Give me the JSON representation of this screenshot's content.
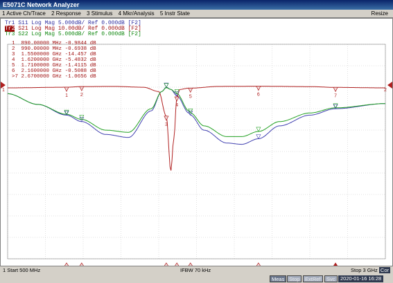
{
  "window": {
    "title": "E5071C Network Analyzer"
  },
  "menu": {
    "items": [
      "1 Active Ch/Trace",
      "2 Response",
      "3 Stimulus",
      "4 Mkr/Analysis",
      "5 Instr State"
    ],
    "resize": "Resize"
  },
  "traces": {
    "tr1": {
      "id": "Tr1",
      "label": "S11 Log Mag 5.000dB/ Ref 0.000dB [F2]"
    },
    "tr2": {
      "id": "Tr2",
      "label": "S21 Log Mag 10.00dB/ Ref 0.000dB [F2]"
    },
    "tr3": {
      "id": "Tr3",
      "label": "S22 Log Mag 5.000dB/ Ref 0.000dB [F2]"
    }
  },
  "markers": [
    {
      "num": "1",
      "freq": "890.00000 MHz",
      "val": "-0.9844 dB"
    },
    {
      "num": "2",
      "freq": "990.00000 MHz",
      "val": "-0.6938 dB"
    },
    {
      "num": "3",
      "freq": "1.5500000 GHz",
      "val": "-14.457 dB"
    },
    {
      "num": "4",
      "freq": "1.6200000 GHz",
      "val": "-5.4832 dB"
    },
    {
      "num": "5",
      "freq": "1.7100000 GHz",
      "val": "-1.4115 dB"
    },
    {
      "num": "6",
      "freq": "2.1600000 GHz",
      "val": "-0.5088 dB"
    },
    {
      "num": ">7",
      "freq": "2.6700000 GHz",
      "val": "-1.0656 dB"
    }
  ],
  "marker_labels": [
    "1",
    "2",
    "3",
    "4",
    "5",
    "6",
    "7"
  ],
  "ref_labels": {
    "left": "1",
    "right": "2"
  },
  "status": {
    "start": "1 Start 500 MHz",
    "ifbw": "IFBW 70 kHz",
    "stop": "Stop 3 GHz",
    "cor": "Cor"
  },
  "bottom": {
    "meas": "Meas",
    "stop": "Stop",
    "extref": "ExtRef",
    "svc": "Svc",
    "datetime": "2020-01-16 16:28"
  },
  "colors": {
    "s11": "#4040b0",
    "s21": "#b02020",
    "s22": "#20a020",
    "grid": "#c0c0c0",
    "marker_fill": "#f0d8d8"
  },
  "chart_data": {
    "type": "line",
    "x_unit": "GHz",
    "xlim": [
      0.5,
      3.0
    ],
    "series": [
      {
        "name": "S11",
        "x": [
          0.5,
          0.7,
          0.89,
          0.99,
          1.15,
          1.3,
          1.45,
          1.52,
          1.55,
          1.58,
          1.62,
          1.7,
          1.71,
          1.8,
          1.95,
          2.05,
          2.16,
          2.3,
          2.5,
          2.67,
          3.0
        ],
        "y": [
          -2.0,
          -4.5,
          -7.0,
          -8.5,
          -11.5,
          -12.2,
          -6.0,
          -1.5,
          -0.5,
          -1.0,
          -2.5,
          -6.5,
          -7.0,
          -10.5,
          -13.5,
          -13.8,
          -12.5,
          -9.5,
          -7.0,
          -5.5,
          -4.3
        ]
      },
      {
        "name": "S21",
        "x": [
          0.5,
          0.89,
          0.99,
          1.2,
          1.4,
          1.5,
          1.55,
          1.58,
          1.6,
          1.62,
          1.64,
          1.7,
          1.71,
          1.9,
          2.16,
          2.5,
          2.67,
          3.0
        ],
        "y": [
          -1.3,
          -0.98,
          -0.69,
          -0.6,
          -1.0,
          -3.0,
          -14.457,
          -40.0,
          -25.0,
          -5.48,
          -2.0,
          -1.41,
          -1.41,
          -0.6,
          -0.51,
          -0.7,
          -1.07,
          -1.3
        ]
      },
      {
        "name": "S22",
        "x": [
          0.5,
          0.7,
          0.89,
          0.99,
          1.15,
          1.3,
          1.45,
          1.52,
          1.55,
          1.58,
          1.62,
          1.7,
          1.71,
          1.8,
          1.95,
          2.05,
          2.16,
          2.3,
          2.5,
          2.67,
          3.0
        ],
        "y": [
          -2.0,
          -4.5,
          -6.8,
          -8.0,
          -10.5,
          -11.0,
          -5.5,
          -1.5,
          -0.6,
          -1.0,
          -2.0,
          -6.0,
          -6.5,
          -9.5,
          -12.0,
          -12.0,
          -10.8,
          -8.5,
          -6.5,
          -5.3,
          -4.3
        ]
      }
    ],
    "marker_x": [
      0.89,
      0.99,
      1.55,
      1.62,
      1.71,
      2.16,
      2.67
    ]
  }
}
